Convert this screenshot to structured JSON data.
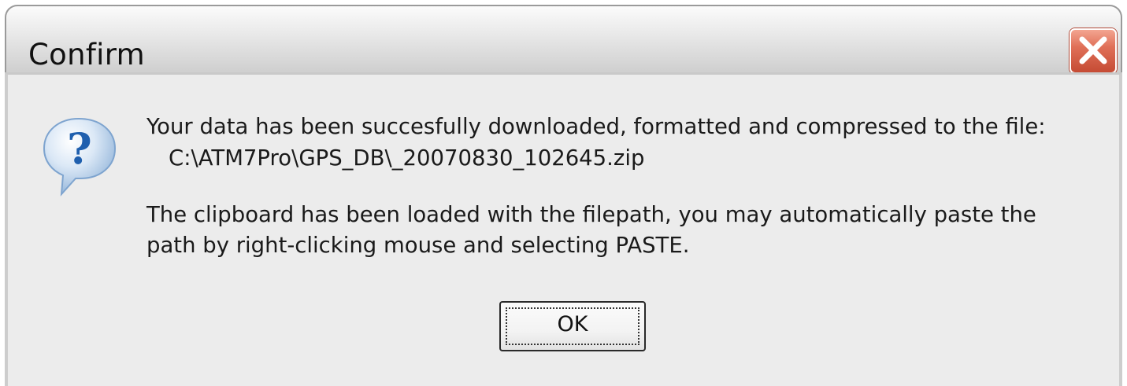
{
  "window": {
    "title": "Confirm",
    "close_icon": "close-x-icon"
  },
  "message": {
    "icon": "question-icon",
    "line1": "Your data has been succesfully downloaded, formatted and compressed to the file:",
    "line2": "C:\\ATM7Pro\\GPS_DB\\_20070830_102645.zip",
    "line3": "The clipboard has been loaded with the filepath, you may automatically paste the",
    "line4": "path by right-clicking mouse and selecting PASTE."
  },
  "buttons": {
    "ok_label": "OK"
  },
  "colors": {
    "close_button": "#d85a42",
    "dialog_background": "#ececec",
    "question_icon": "#2f6fb8"
  }
}
